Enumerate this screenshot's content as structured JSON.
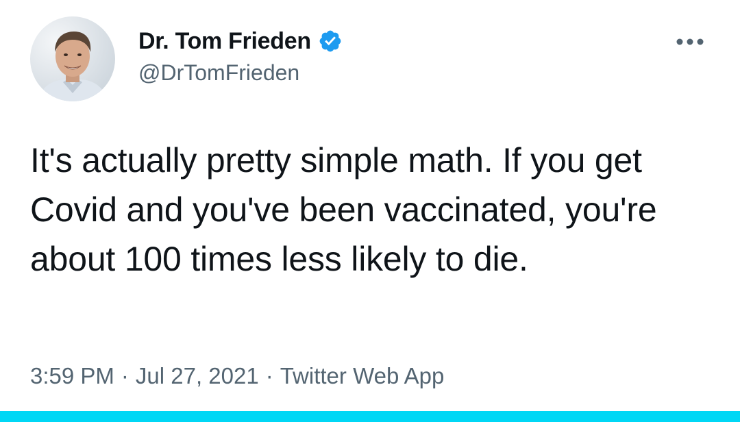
{
  "tweet": {
    "author": {
      "display_name": "Dr. Tom Frieden",
      "handle": "@DrTomFrieden",
      "verified": true,
      "avatar_icon": "profile-photo"
    },
    "more_icon": "ellipsis-icon",
    "text": "It's actually pretty simple math. If you get Covid and you've been vaccinated, you're about 100 times less likely to die.",
    "time": "3:59 PM",
    "separator": "·",
    "date": "Jul 27, 2021",
    "source": "Twitter Web App"
  },
  "colors": {
    "text_primary": "#0f1419",
    "text_secondary": "#536471",
    "verified_badge": "#1d9bf0",
    "bottom_bar": "#00d7f5"
  }
}
